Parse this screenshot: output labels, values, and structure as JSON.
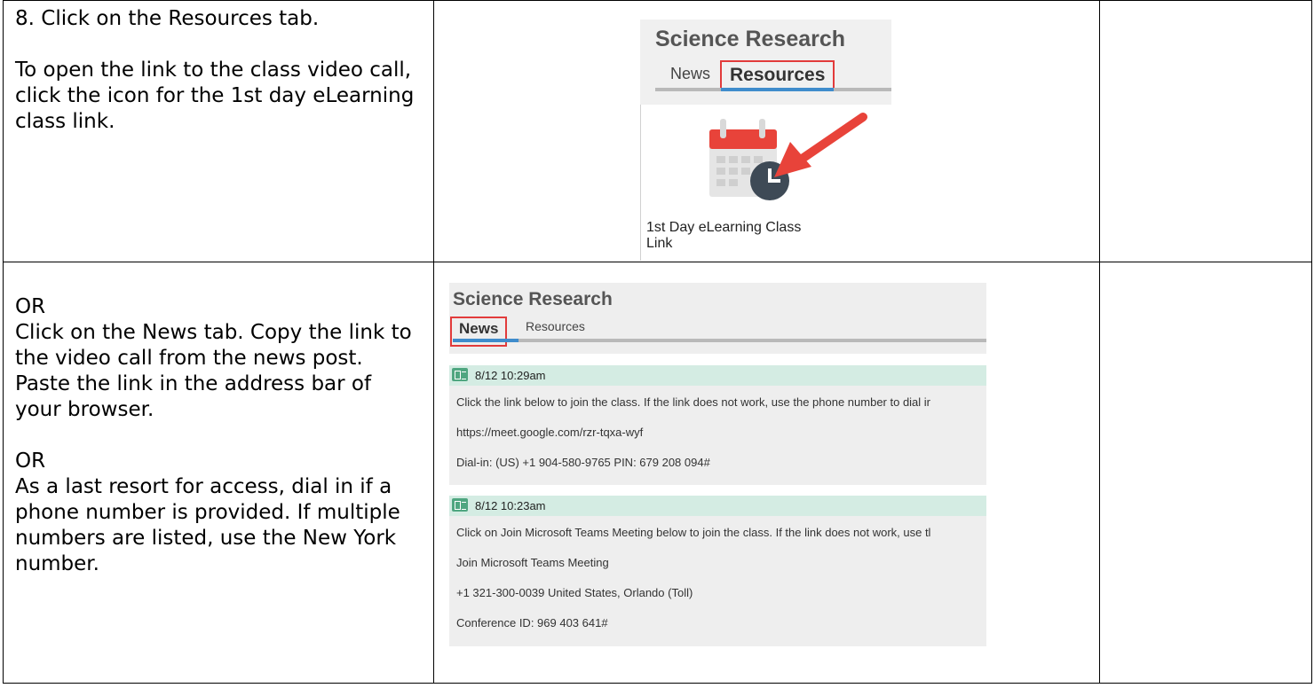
{
  "rows": [
    {
      "instructions": [
        "8. Click on the Resources tab.",
        "To open the link to the class video call, click the icon for the 1st day eLearning class link."
      ],
      "screenshot": {
        "course_title": "Science Research",
        "tabs": [
          "News",
          "Resources"
        ],
        "resource_label": "1st Day eLearning Class Link",
        "resource_icon": "calendar-clock-icon"
      }
    },
    {
      "instructions": [
        "OR",
        "Click on the News tab. Copy the link to the video call from the news post. Paste the link in the address bar of your browser.",
        "OR",
        "As a last resort for access, dial in if a phone number is provided. If multiple numbers are listed, use the New York number."
      ],
      "screenshot": {
        "course_title": "Science Research",
        "tabs": [
          "News",
          "Resources"
        ],
        "posts": [
          {
            "timestamp": "8/12 10:29am",
            "lines": [
              "Click the link below to join the class. If the link does not work, use the phone number to dial ir",
              "https://meet.google.com/rzr-tqxa-wyf",
              "Dial-in: (US) +1 904-580-9765 PIN: 679 208 094#"
            ]
          },
          {
            "timestamp": "8/12 10:23am",
            "lines": [
              "Click on Join Microsoft Teams Meeting below to join the class. If the link does not work, use tl",
              "Join Microsoft Teams Meeting",
              "+1 321-300-0039   United States, Orlando (Toll)",
              "Conference ID: 969 403 641#"
            ]
          }
        ]
      }
    }
  ],
  "colors": {
    "highlight_box": "#e23b3b",
    "tab_underline": "#3f8ccc",
    "post_header": "#d4ece3",
    "news_icon": "#4fa680"
  }
}
